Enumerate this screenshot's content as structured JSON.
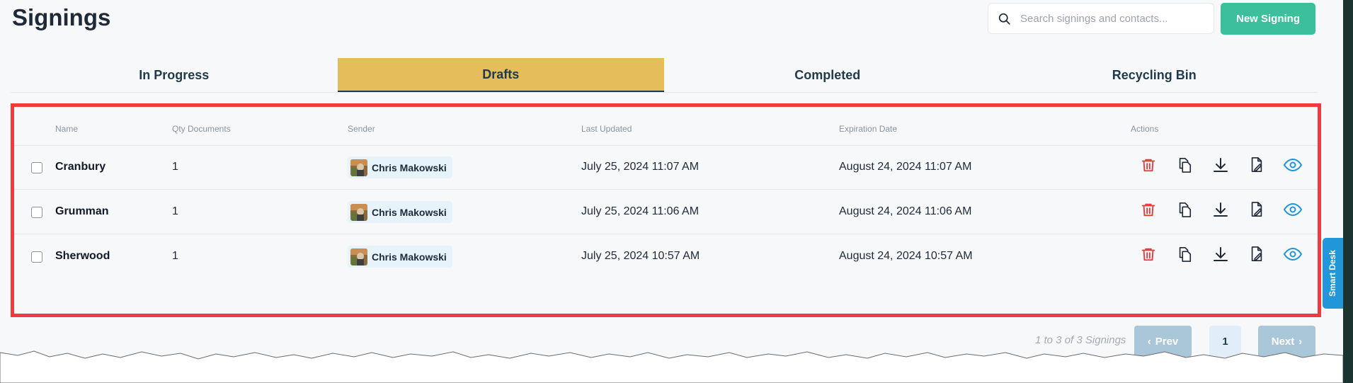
{
  "header": {
    "title": "Signings",
    "search_placeholder": "Search signings and contacts...",
    "new_button": "New Signing"
  },
  "tabs": [
    {
      "label": "In Progress",
      "active": false
    },
    {
      "label": "Drafts",
      "active": true
    },
    {
      "label": "Completed",
      "active": false
    },
    {
      "label": "Recycling Bin",
      "active": false
    }
  ],
  "table": {
    "columns": [
      "Name",
      "Qty Documents",
      "Sender",
      "Last Updated",
      "Expiration Date",
      "Actions"
    ],
    "rows": [
      {
        "name": "Cranbury",
        "qty": "1",
        "sender": "Chris Makowski",
        "last_updated": "July 25, 2024 11:07 AM",
        "expiration": "August 24, 2024 11:07 AM"
      },
      {
        "name": "Grumman",
        "qty": "1",
        "sender": "Chris Makowski",
        "last_updated": "July 25, 2024 11:06 AM",
        "expiration": "August 24, 2024 11:06 AM"
      },
      {
        "name": "Sherwood",
        "qty": "1",
        "sender": "Chris Makowski",
        "last_updated": "July 25, 2024 10:57 AM",
        "expiration": "August 24, 2024 10:57 AM"
      }
    ],
    "action_icons": [
      "trash-icon",
      "copy-icon",
      "download-icon",
      "edit-document-icon",
      "eye-icon"
    ]
  },
  "pagination": {
    "info": "1 to 3 of 3 Signings",
    "prev": "Prev",
    "page": "1",
    "next": "Next"
  },
  "side_tab": {
    "label": "Smart Desk"
  },
  "colors": {
    "accent_green": "#3cbf9b",
    "active_tab": "#e5bd5b",
    "highlight_border": "#ef3b3f",
    "trash_red": "#e53935",
    "eye_blue": "#2196d9",
    "side_tab_blue": "#2196d9"
  }
}
